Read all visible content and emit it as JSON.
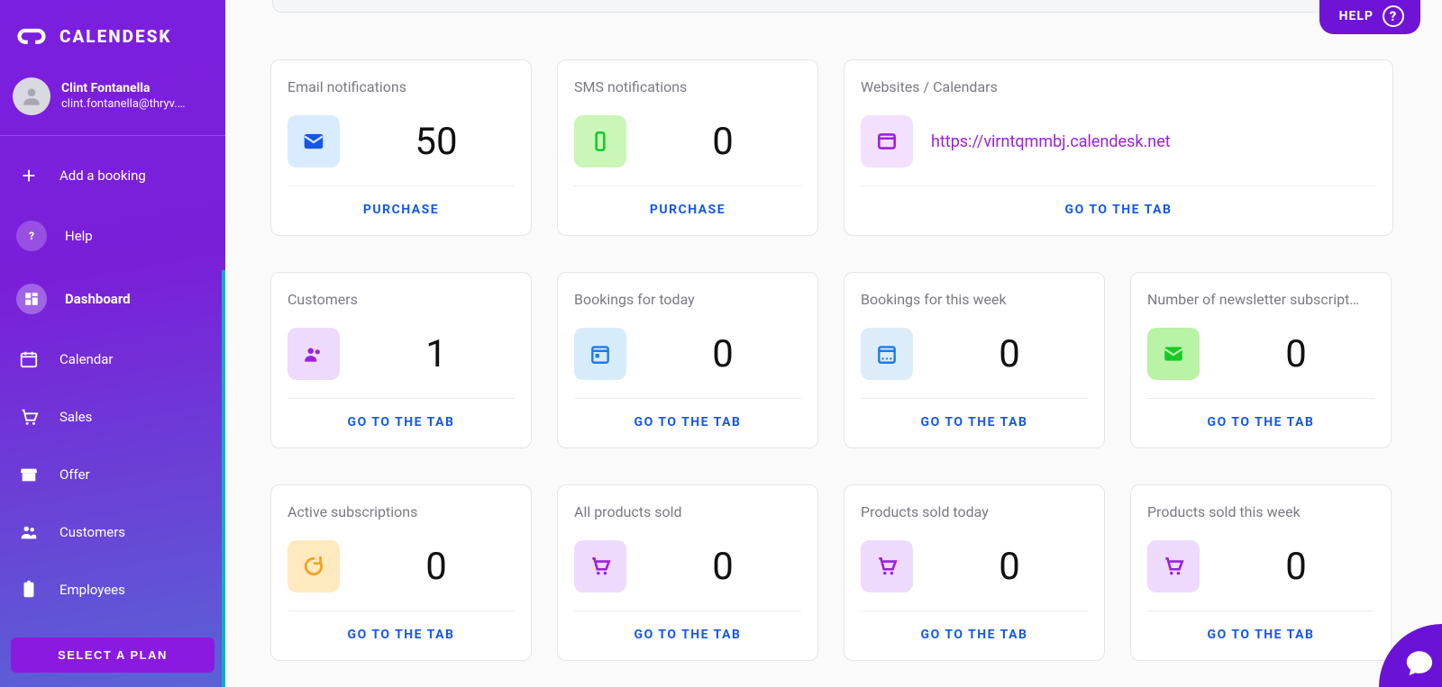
{
  "brand": {
    "name": "CALENDESK"
  },
  "user": {
    "name": "Clint Fontanella",
    "email": "clint.fontanella@thryv.…"
  },
  "help_label": "HELP",
  "sidebar": {
    "add_booking": "Add a booking",
    "items": [
      {
        "key": "help",
        "label": "Help",
        "icon": "help-icon"
      },
      {
        "key": "dashboard",
        "label": "Dashboard",
        "icon": "dashboard-icon"
      },
      {
        "key": "calendar",
        "label": "Calendar",
        "icon": "calendar-icon"
      },
      {
        "key": "sales",
        "label": "Sales",
        "icon": "cart-icon"
      },
      {
        "key": "offer",
        "label": "Offer",
        "icon": "store-icon"
      },
      {
        "key": "customers",
        "label": "Customers",
        "icon": "people-icon"
      },
      {
        "key": "employees",
        "label": "Employees",
        "icon": "badge-icon"
      }
    ],
    "select_plan": "SELECT A PLAN"
  },
  "actions": {
    "purchase": "PURCHASE",
    "go_to_tab": "GO TO THE TAB"
  },
  "cards": {
    "email_notifications": {
      "title": "Email notifications",
      "value": "50",
      "action": "purchase"
    },
    "sms_notifications": {
      "title": "SMS notifications",
      "value": "0",
      "action": "purchase"
    },
    "websites": {
      "title": "Websites / Calendars",
      "url": "https://virntqmmbj.calendesk.net",
      "action": "go_to_tab"
    },
    "customers": {
      "title": "Customers",
      "value": "1",
      "action": "go_to_tab"
    },
    "bookings_today": {
      "title": "Bookings for today",
      "value": "0",
      "action": "go_to_tab"
    },
    "bookings_week": {
      "title": "Bookings for this week",
      "value": "0",
      "action": "go_to_tab"
    },
    "newsletter": {
      "title": "Number of newsletter subscript…",
      "value": "0",
      "action": "go_to_tab"
    },
    "active_subs": {
      "title": "Active subscriptions",
      "value": "0",
      "action": "go_to_tab"
    },
    "all_products": {
      "title": "All products sold",
      "value": "0",
      "action": "go_to_tab"
    },
    "products_today": {
      "title": "Products sold today",
      "value": "0",
      "action": "go_to_tab"
    },
    "products_week": {
      "title": "Products sold this week",
      "value": "0",
      "action": "go_to_tab"
    }
  }
}
